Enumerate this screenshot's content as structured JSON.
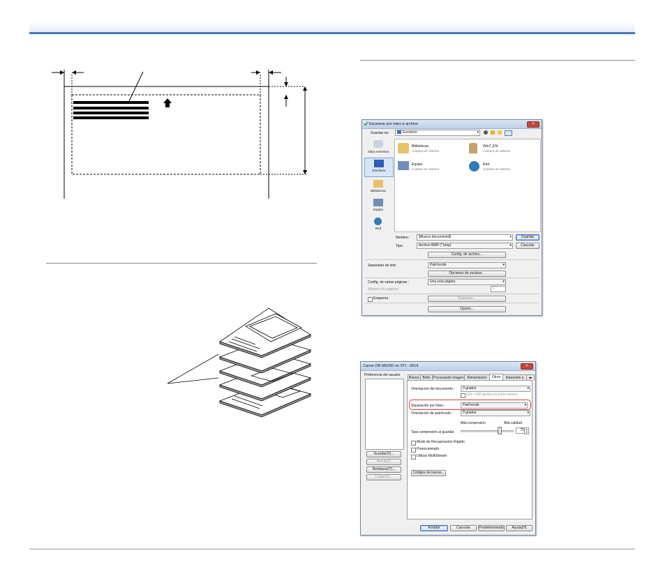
{
  "dialog1": {
    "title": "Escanear por lotes a archivo",
    "save_in_label": "Guardar en:",
    "save_in_value": "Escritorio",
    "places": [
      "Sitios recientes",
      "Escritorio",
      "Bibliotecas",
      "Equipo",
      "Red"
    ],
    "items": [
      {
        "name": "Bibliotecas",
        "sub": "Carpeta de sistema"
      },
      {
        "name": "Win7_EN",
        "sub": "Carpeta de sistema"
      },
      {
        "name": "Equipo",
        "sub": "Carpeta de sistema"
      },
      {
        "name": "Red",
        "sub": "Carpeta de sistema"
      }
    ],
    "name_label": "Nombre:",
    "name_value": "$Nuevo documento$",
    "type_label": "Tipo:",
    "type_value": "Archivo BMP (*.bmp)",
    "save_button": "Guardar",
    "cancel_button": "Cancelar",
    "file_config_button": "Config. de archivo...",
    "batch_sep_label": "Separador de lote:",
    "batch_sep_value": "Patchcode",
    "scanner_options_button": "Opciones de escáner...",
    "multipage_label": "Config. de varias páginas :",
    "multipage_value": "Una sola página",
    "page_count_label": "Número de páginas:",
    "page_count_value": "2",
    "scheme_label": "Esquema",
    "scheme_button": "Esquema...",
    "option_button": "Opción..."
  },
  "dialog2": {
    "title": "Canon DR-M1060 on STI - 0014",
    "user_pref_label": "Preferencia del usuario",
    "side_buttons": [
      "Guardar(V)...",
      "Borrar(J)",
      "Restaurar(Y)...",
      "Copiar(K)..."
    ],
    "tabs": [
      "Básico",
      "Brillo",
      "Procesando imagen",
      "Alimentación",
      "Otros",
      "Impresión a"
    ],
    "active_tab": "Otros",
    "doc_orientation_label": "Orientación del documento :",
    "doc_orientation_value": "0 grados",
    "rotate_back_label": "Gire +180 grados la parte trasera",
    "batch_sep_label": "Separación por lotes :",
    "batch_sep_value": "Patchcode",
    "patch_orientation_label": "Orientación de patchcode :",
    "patch_orientation_value": "0 grados",
    "high_compression": "Alta compresion",
    "high_quality": "Alta calidad",
    "compression_label": "Tasa compresión al guardar",
    "compression_value": "75",
    "rapid_recovery_label": "Modo de Recuperación Rápido",
    "prescan_label": "Preescaneado",
    "multistream_label": "Utilizar MultiStream",
    "barcode_button": "Códigos de barras...",
    "ok_button": "Aceptar",
    "cancel_button": "Cancelar",
    "default_button": "Predeterminado",
    "help_button": "Ayuda(H)"
  }
}
